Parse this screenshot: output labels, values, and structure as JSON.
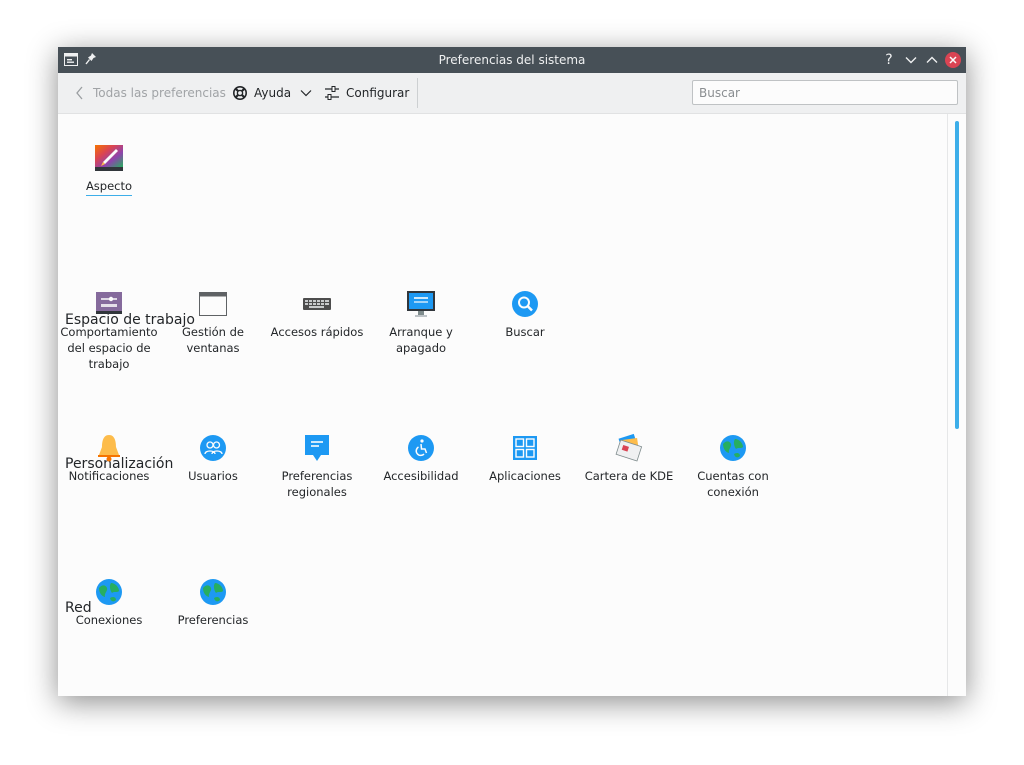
{
  "window": {
    "title": "Preferencias del sistema"
  },
  "titlebar": {
    "help_glyph": "?",
    "minimize_glyph": "⌄",
    "maximize_glyph": "⌃",
    "close_glyph": "×"
  },
  "toolbar": {
    "back_label": "Todas las preferencias",
    "help_label": "Ayuda",
    "configure_label": "Configurar",
    "search_placeholder": "Buscar"
  },
  "top_items": [
    {
      "label": "Aspecto",
      "icon": "appearance-icon"
    }
  ],
  "categories": [
    {
      "title": "Espacio de trabajo",
      "items": [
        {
          "label": "Comportamiento del espacio de trabajo",
          "icon": "workspace-icon"
        },
        {
          "label": "Gestión de ventanas",
          "icon": "window-icon"
        },
        {
          "label": "Accesos rápidos",
          "icon": "keyboard-icon"
        },
        {
          "label": "Arranque y apagado",
          "icon": "monitor-icon"
        },
        {
          "label": "Buscar",
          "icon": "search-icon"
        }
      ]
    },
    {
      "title": "Personalización",
      "items": [
        {
          "label": "Notificaciones",
          "icon": "bell-icon"
        },
        {
          "label": "Usuarios",
          "icon": "users-icon"
        },
        {
          "label": "Preferencias regionales",
          "icon": "regional-icon"
        },
        {
          "label": "Accesibilidad",
          "icon": "accessibility-icon"
        },
        {
          "label": "Aplicaciones",
          "icon": "applications-icon"
        },
        {
          "label": "Cartera de KDE",
          "icon": "wallet-icon"
        },
        {
          "label": "Cuentas con conexión",
          "icon": "globe-icon"
        }
      ]
    },
    {
      "title": "Red",
      "items": [
        {
          "label": "Conexiones",
          "icon": "globe-icon"
        },
        {
          "label": "Preferencias",
          "icon": "globe-icon"
        }
      ]
    }
  ],
  "colors": {
    "accent": "#3daee9",
    "titlebar": "#475057",
    "close": "#da4453"
  }
}
